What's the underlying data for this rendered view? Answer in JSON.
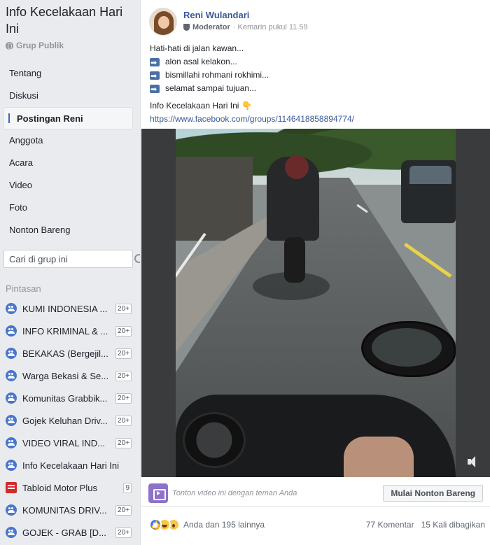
{
  "group": {
    "title": "Info Kecelakaan Hari Ini",
    "privacy": "Grup Publik"
  },
  "nav": {
    "items": [
      {
        "label": "Tentang"
      },
      {
        "label": "Diskusi"
      },
      {
        "label": "Postingan Reni",
        "active": true
      },
      {
        "label": "Anggota"
      },
      {
        "label": "Acara"
      },
      {
        "label": "Video"
      },
      {
        "label": "Foto"
      },
      {
        "label": "Nonton Bareng"
      }
    ]
  },
  "search": {
    "placeholder": "Cari di grup ini"
  },
  "shortcuts": {
    "title": "Pintasan",
    "items": [
      {
        "label": "KUMI INDONESIA ...",
        "badge": "20+",
        "icon": "group-icon"
      },
      {
        "label": "INFO KRIMINAL & ...",
        "badge": "20+",
        "icon": "group-icon"
      },
      {
        "label": "BEKAKAS (Bergejil...",
        "badge": "20+",
        "icon": "group-icon"
      },
      {
        "label": "Warga Bekasi & Se...",
        "badge": "20+",
        "icon": "group-icon"
      },
      {
        "label": "Komunitas Grabbik...",
        "badge": "20+",
        "icon": "group-icon"
      },
      {
        "label": "Gojek Keluhan Driv...",
        "badge": "20+",
        "icon": "group-icon"
      },
      {
        "label": "VIDEO VIRAL IND...",
        "badge": "20+",
        "icon": "group-icon"
      },
      {
        "label": "Info Kecelakaan Hari Ini",
        "badge": "",
        "icon": "group-icon"
      },
      {
        "label": "Tabloid Motor Plus",
        "badge": "9",
        "icon": "page-icon"
      },
      {
        "label": "KOMUNITAS DRIV...",
        "badge": "20+",
        "icon": "group-icon"
      },
      {
        "label": "GOJEK - GRAB [D...",
        "badge": "20+",
        "icon": "group-icon"
      }
    ]
  },
  "post": {
    "author": "Reni Wulandari",
    "role": "Moderator",
    "time": "· Kemarin pukul 11.59",
    "lines": {
      "l1": "Hati-hati di jalan kawan...",
      "l2": "alon asal kelakon...",
      "l3": "bismillahi rohmani rokhimi...",
      "l4": "selamat sampai tujuan...",
      "l5": "Info Kecelakaan Hari Ini",
      "link": "https://www.facebook.com/groups/1146418858894774/"
    },
    "watch": {
      "text": "Tonton video ini dengan teman Anda",
      "button": "Mulai Nonton Bareng"
    },
    "reactions": {
      "text": "Anda dan 195 lainnya",
      "comments": "77 Komentar",
      "shares": "15 Kali dibagikan"
    }
  }
}
